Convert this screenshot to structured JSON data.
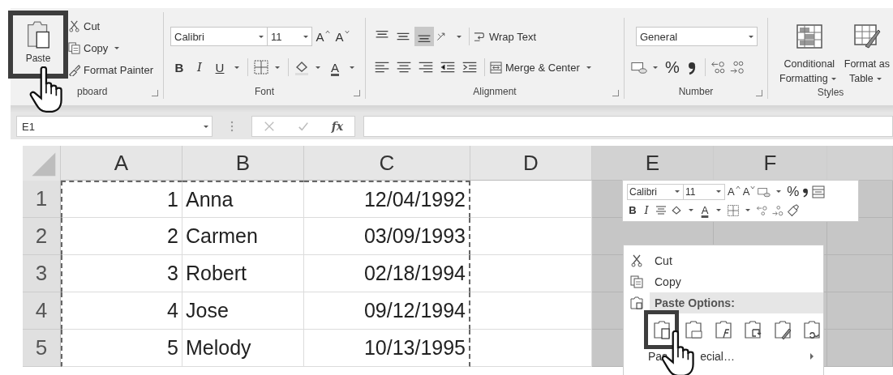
{
  "ribbon": {
    "clipboard": {
      "paste": {
        "label": "Paste",
        "highlighted": true
      },
      "buttons": [
        {
          "kind": "scissors",
          "label": "Cut"
        },
        {
          "kind": "copy",
          "label": "Copy",
          "dropdown": true
        },
        {
          "kind": "brush",
          "label": "Format Painter"
        }
      ],
      "group_label": "pboard"
    },
    "font": {
      "font_name": "Calibri",
      "font_size": "11",
      "grow": "A",
      "shrink": "A",
      "styles": [
        {
          "kind": "bold",
          "glyph": "B"
        },
        {
          "kind": "italic",
          "glyph": "I"
        },
        {
          "kind": "underline",
          "glyph": "U"
        }
      ],
      "font_color": "A",
      "group_label": "Font"
    },
    "alignment": {
      "vertical": [
        {
          "kind": "top",
          "selected": false
        },
        {
          "kind": "middle",
          "selected": false
        },
        {
          "kind": "bottom",
          "selected": true
        }
      ],
      "horizontal": [
        {
          "kind": "left"
        },
        {
          "kind": "center"
        },
        {
          "kind": "right"
        }
      ],
      "wrap_text": "Wrap Text",
      "merge_center": "Merge & Center",
      "group_label": "Alignment"
    },
    "number": {
      "format": "General",
      "percent": "%",
      "group_label": "Number"
    },
    "styles": {
      "buttons": [
        {
          "kind": "conditional",
          "lines": [
            "Conditional",
            "Formatting"
          ]
        },
        {
          "kind": "table",
          "lines": [
            "Format as",
            "Table"
          ]
        }
      ],
      "group_label": "Styles"
    }
  },
  "formula_bar": {
    "name_box": "E1",
    "fx": "fx"
  },
  "sheet": {
    "columns": [
      {
        "label": "A",
        "shaded": false,
        "copied": true
      },
      {
        "label": "B",
        "shaded": false,
        "copied": true
      },
      {
        "label": "C",
        "shaded": false,
        "copied": true
      },
      {
        "label": "D",
        "shaded": false,
        "copied": false
      },
      {
        "label": "E",
        "shaded": true,
        "copied": false
      },
      {
        "label": "F",
        "shaded": true,
        "copied": false
      },
      {
        "shaded": true,
        "copied": false
      }
    ],
    "rows": [
      {
        "header": "1",
        "cells": [
          "1",
          "Anna",
          "12/04/1992"
        ]
      },
      {
        "header": "2",
        "cells": [
          "2",
          "Carmen",
          "03/09/1993"
        ]
      },
      {
        "header": "3",
        "cells": [
          "3",
          "Robert",
          "02/18/1994"
        ]
      },
      {
        "header": "4",
        "cells": [
          "4",
          "Jose",
          "09/12/1994"
        ]
      },
      {
        "header": "5",
        "cells": [
          "5",
          "Melody",
          "10/13/1995"
        ]
      }
    ]
  },
  "mini_toolbar": {
    "font_name": "Calibri",
    "font_size": "11",
    "grow": "A",
    "shrink": "A",
    "percent": "%",
    "bold": "B",
    "italic": "I",
    "font_color": "A"
  },
  "context_menu": {
    "items": [
      {
        "kind": "cut",
        "label": "Cut"
      },
      {
        "kind": "copy",
        "label": "Copy"
      },
      {
        "kind": "header",
        "label": "Paste Options:"
      },
      {
        "kind": "paste_icons",
        "options": [
          {
            "kind": "paste",
            "highlighted": true
          },
          {
            "kind": "values",
            "highlighted": false
          },
          {
            "kind": "formulas",
            "highlighted": false
          },
          {
            "kind": "transpose",
            "highlighted": false
          },
          {
            "kind": "formatting",
            "highlighted": false
          },
          {
            "kind": "link",
            "highlighted": false
          }
        ]
      },
      {
        "kind": "submenu",
        "label_parts": [
          "Pas",
          "ecial…"
        ]
      }
    ]
  }
}
